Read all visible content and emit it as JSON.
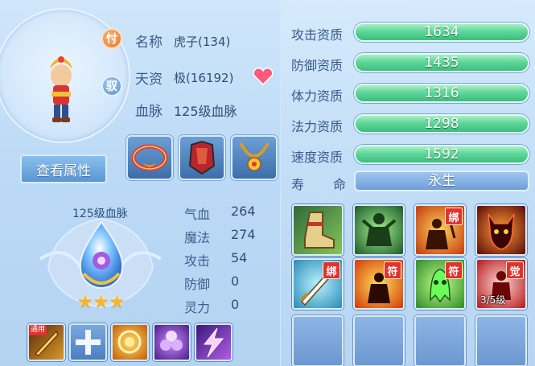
{
  "pet": {
    "name_label": "名称",
    "name_value": "虎子(134)",
    "name_badge": "忖",
    "talent_label": "天资",
    "talent_value": "极(16192)",
    "talent_badge": "驭",
    "blood_label": "血脉",
    "blood_value": "125级血脉",
    "view_attr_button": "查看属性"
  },
  "bloodline": {
    "title": "125级血脉",
    "stars": 3,
    "stats": [
      {
        "name": "气血",
        "value": "264"
      },
      {
        "name": "魔法",
        "value": "274"
      },
      {
        "name": "攻击",
        "value": "54"
      },
      {
        "name": "防御",
        "value": "0"
      },
      {
        "name": "灵力",
        "value": "0"
      }
    ]
  },
  "equipment_icons": [
    "necklace-red-icon",
    "armor-red-icon",
    "necklace-gold-icon"
  ],
  "bottom_skills": [
    {
      "icon": "golden-blade-icon",
      "tag": "通用"
    },
    {
      "icon": "plus-icon",
      "tag": ""
    },
    {
      "icon": "golden-orb-icon",
      "tag": ""
    },
    {
      "icon": "purple-flower-icon",
      "tag": ""
    },
    {
      "icon": "lightning-icon",
      "tag": ""
    }
  ],
  "aptitudes": [
    {
      "label": "攻击资质",
      "value": "1634"
    },
    {
      "label": "防御资质",
      "value": "1435"
    },
    {
      "label": "体力资质",
      "value": "1316"
    },
    {
      "label": "法力资质",
      "value": "1298"
    },
    {
      "label": "速度资质",
      "value": "1592"
    }
  ],
  "lifespan": {
    "label_1": "寿",
    "label_2": "命",
    "value": "永生"
  },
  "skills": [
    {
      "icon": "boot-icon",
      "tag": ""
    },
    {
      "icon": "green-warrior-icon",
      "tag": ""
    },
    {
      "icon": "fire-warrior-icon",
      "tag": "绑"
    },
    {
      "icon": "demon-head-icon",
      "tag": ""
    },
    {
      "icon": "sword-slash-icon",
      "tag": "绑"
    },
    {
      "icon": "fire-shadow-icon",
      "tag": "符"
    },
    {
      "icon": "green-ghost-icon",
      "tag": "符"
    },
    {
      "icon": "red-figure-icon",
      "tag": "觉",
      "overlay": "3/5级"
    }
  ],
  "colors": {
    "bar_green": "#3bbd7d",
    "heart": "#ff5a7a",
    "star": "#f6b728"
  }
}
